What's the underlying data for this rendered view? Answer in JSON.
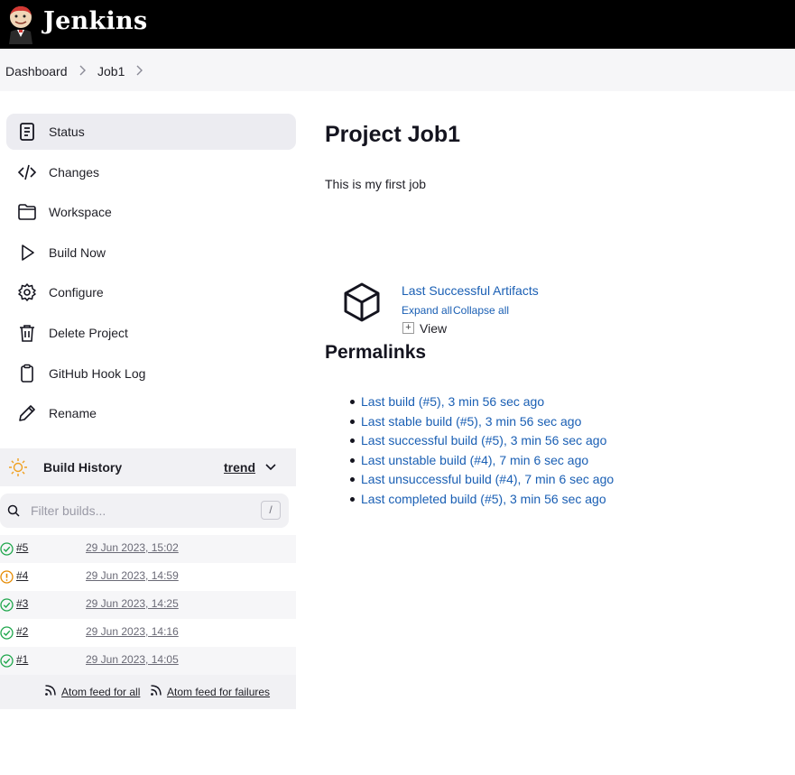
{
  "header": {
    "brand": "Jenkins"
  },
  "breadcrumb": [
    "Dashboard",
    "Job1"
  ],
  "sidebar": {
    "tasks": [
      {
        "label": "Status",
        "icon": "document-icon",
        "active": true
      },
      {
        "label": "Changes",
        "icon": "code-icon"
      },
      {
        "label": "Workspace",
        "icon": "folder-icon"
      },
      {
        "label": "Build Now",
        "icon": "play-icon"
      },
      {
        "label": "Configure",
        "icon": "gear-icon"
      },
      {
        "label": "Delete Project",
        "icon": "trash-icon"
      },
      {
        "label": "GitHub Hook Log",
        "icon": "clipboard-icon"
      },
      {
        "label": "Rename",
        "icon": "pencil-icon"
      }
    ]
  },
  "build_history": {
    "title": "Build History",
    "trend": "trend",
    "filter_placeholder": "Filter builds...",
    "filter_shortcut": "/",
    "builds": [
      {
        "number": "#5",
        "date": "29 Jun 2023, 15:02",
        "status": "success"
      },
      {
        "number": "#4",
        "date": "29 Jun 2023, 14:59",
        "status": "unstable"
      },
      {
        "number": "#3",
        "date": "29 Jun 2023, 14:25",
        "status": "success"
      },
      {
        "number": "#2",
        "date": "29 Jun 2023, 14:16",
        "status": "success"
      },
      {
        "number": "#1",
        "date": "29 Jun 2023, 14:05",
        "status": "success"
      }
    ],
    "feed_all": "Atom feed for all",
    "feed_failures": "Atom feed for failures"
  },
  "main": {
    "title": "Project Job1",
    "description": "This is my first job",
    "artifacts": {
      "link": "Last Successful Artifacts",
      "expand_all": "Expand all",
      "collapse_all": "Collapse all",
      "view": "View"
    },
    "permalinks_title": "Permalinks",
    "permalinks": [
      "Last build (#5), 3 min 56 sec ago",
      "Last stable build (#5), 3 min 56 sec ago",
      "Last successful build (#5), 3 min 56 sec ago",
      "Last unstable build (#4), 7 min 6 sec ago",
      "Last unsuccessful build (#4), 7 min 6 sec ago",
      "Last completed build (#5), 3 min 56 sec ago"
    ]
  },
  "colors": {
    "link": "#1a5fb4",
    "success": "#1ea64b",
    "unstable": "#e68a00",
    "header": "#000000"
  }
}
